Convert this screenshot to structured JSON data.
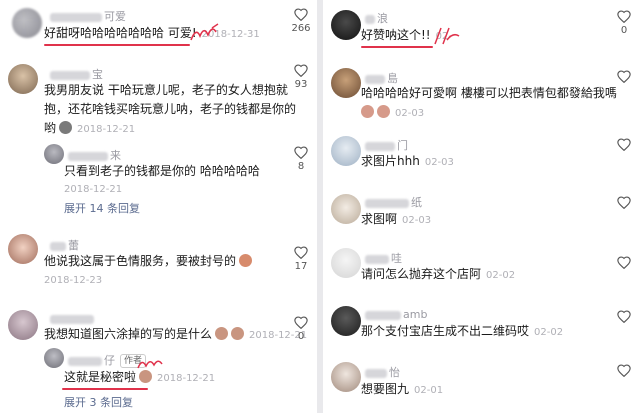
{
  "left": {
    "comments": [
      {
        "username_visible": "可爱",
        "text": "好甜呀哈哈哈哈哈哈哈 可爱!",
        "date": "2018-12-31",
        "likes": "266"
      },
      {
        "username_visible": "宝",
        "text_lines": [
          "我男朋友说 干哈玩意儿呢，老子的女人想抱就",
          "抱，还花啥钱买啥玩意儿呐，老子的钱都是你的",
          "哟"
        ],
        "date": "2018-12-21",
        "likes": "93",
        "reply": {
          "username_visible": "来",
          "text": "只看到老子的钱都是你的 哈哈哈哈哈",
          "date": "2018-12-21",
          "likes": "8"
        },
        "expand": "展开 14 条回复"
      },
      {
        "username_visible": "蕾",
        "text": "他说我这属于色情服务，要被封号的",
        "date": "2018-12-23",
        "likes": "17"
      },
      {
        "username_visible": "",
        "text": "我想知道图六涂掉的写的是什么",
        "date": "2018-12-21",
        "likes": "0",
        "reply": {
          "username_visible": "仔",
          "author_tag": "作者",
          "text": "这就是秘密啦",
          "date": "2018-12-21"
        },
        "expand": "展开 3 条回复"
      }
    ]
  },
  "right": {
    "comments": [
      {
        "username_visible": "浪",
        "text": "好赞呐这个!!",
        "date": "02-",
        "likes": "0"
      },
      {
        "username_visible": "島",
        "text": "哈哈哈哈好可愛啊 樓樓可以把表情包都發給我嗎",
        "date": "02-03"
      },
      {
        "username_visible": "门",
        "text": "求图片hhh",
        "date": "02-03"
      },
      {
        "username_visible": "纸",
        "text": "求图啊",
        "date": "02-03"
      },
      {
        "username_visible": "哇",
        "text": "请问怎么抛弃这个店阿",
        "date": "02-02"
      },
      {
        "username_visible": "amb",
        "text": "那个支付宝店生成不出二维码哎",
        "date": "02-02"
      },
      {
        "username_visible": "怡",
        "text": "想要图九",
        "date": "02-01"
      }
    ]
  },
  "colors": {
    "highlight": "#e0324b",
    "link": "#5b6b8f",
    "meta": "#b0b0b6"
  },
  "icons": [
    "heart-icon",
    "emoji-icon",
    "avatar"
  ]
}
